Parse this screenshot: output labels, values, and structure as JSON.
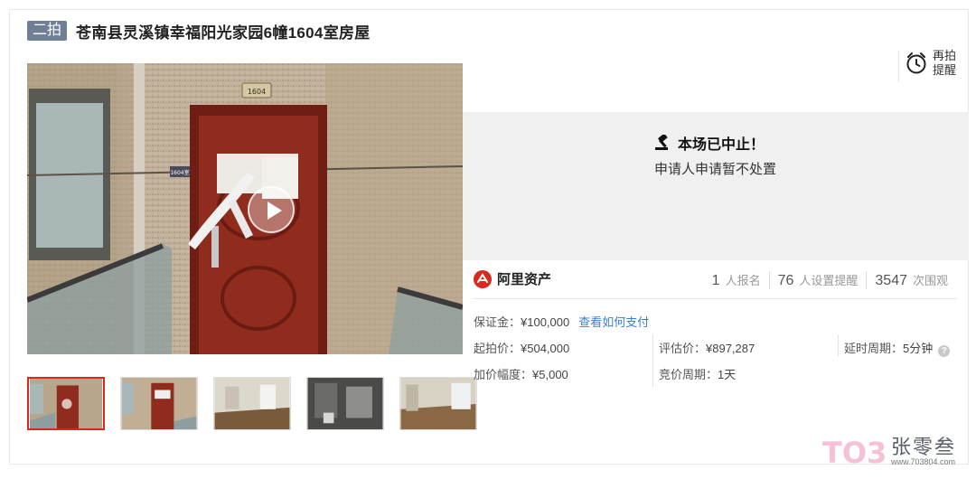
{
  "header": {
    "round_badge": "二拍",
    "title": "苍南县灵溪镇幸福阳光家园6幢1604室房屋"
  },
  "media": {
    "door_plate": "1604",
    "side_plate": "1604室",
    "play_icon": "play-icon"
  },
  "thumbnails": [
    {
      "label": "door-photo-1"
    },
    {
      "label": "door-photo-2"
    },
    {
      "label": "room-photo-1"
    },
    {
      "label": "room-photo-2"
    },
    {
      "label": "room-photo-3"
    }
  ],
  "reminder": {
    "label": "再拍提醒",
    "icon": "alarm-clock-icon"
  },
  "status": {
    "icon": "gavel-icon",
    "title": "本场已中止！",
    "subtitle": "申请人申请暂不处置"
  },
  "brand": {
    "name": "阿里资产",
    "icon": "ali-assets-logo"
  },
  "stats": [
    {
      "num": "1",
      "label": "人报名"
    },
    {
      "num": "76",
      "label": "人设置提醒"
    },
    {
      "num": "3547",
      "label": "次围观"
    }
  ],
  "details": {
    "deposit_label": "保证金：",
    "deposit_value": "¥100,000",
    "pay_link": "查看如何支付",
    "start_price_label": "起拍价：",
    "start_price_value": "¥504,000",
    "appraisal_label": "评估价：",
    "appraisal_value": "¥897,287",
    "delay_label": "延时周期：",
    "delay_value": "5分钟",
    "increment_label": "加价幅度：",
    "increment_value": "¥5,000",
    "cycle_label": "竞价周期：",
    "cycle_value": "1天"
  },
  "watermark": {
    "logo_text": "TO3",
    "name": "张零叁",
    "url": "www.703804.com"
  },
  "colors": {
    "badge": "#6f7f96",
    "link": "#3b7dd8",
    "brand_red": "#d9281e",
    "status_bg": "#f0f0f0"
  }
}
